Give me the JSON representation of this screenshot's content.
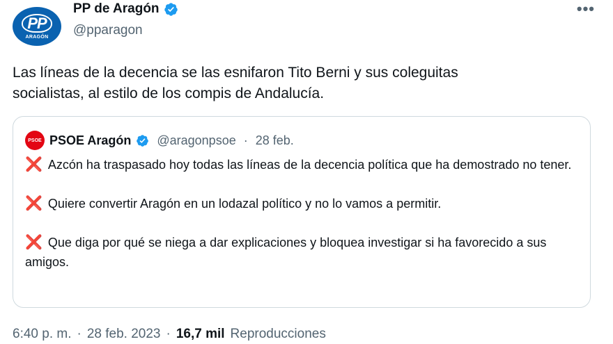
{
  "author": {
    "name": "PP de Aragón",
    "handle": "@pparagon",
    "avatar_text": "PP",
    "avatar_subtext": "ARAGÓN"
  },
  "more_label": "•••",
  "tweet": {
    "line1": "Las líneas de la decencia se las esnifaron Tito Berni y sus coleguitas",
    "line2": "socialistas, al estilo de los compis de Andalucía."
  },
  "quoted": {
    "avatar_text": "PSOE",
    "name": "PSOE Aragón",
    "handle": "@aragonpsoe",
    "separator": "·",
    "date": "28 feb.",
    "cross_icon": "❌",
    "paragraphs": [
      "Azcón ha traspasado hoy todas las líneas de la decencia política que ha demostrado no tener.",
      "Quiere convertir Aragón en un lodazal político y no lo vamos a permitir.",
      "Que diga por qué se niega a dar explicaciones y bloquea investigar si ha favorecido a sus amigos."
    ]
  },
  "footer": {
    "time": "6:40 p. m.",
    "sep1": "·",
    "date": "28 feb. 2023",
    "sep2": "·",
    "views_count": "16,7 mil",
    "views_label": "Reproducciones"
  },
  "colors": {
    "verified": "#1d9bf0",
    "pp_blue": "#0a62b0",
    "psoe_red": "#e30613",
    "cross_red": "#dd2e44"
  }
}
